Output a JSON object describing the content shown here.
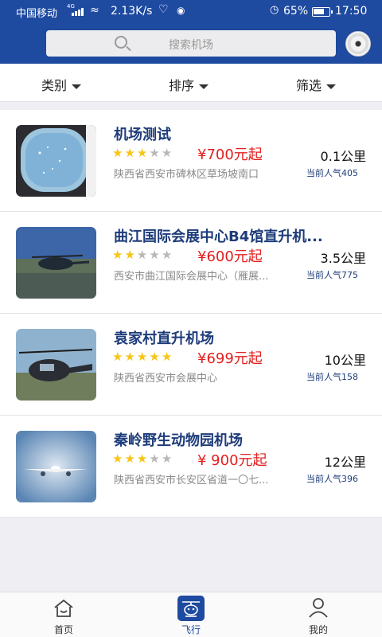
{
  "status_bar": {
    "carrier": "中国移动",
    "network": "4G",
    "speed": "2.13K/s",
    "battery": "65%",
    "time": "17:50"
  },
  "search": {
    "placeholder": "搜索机场",
    "icon": "search-icon"
  },
  "filters": [
    {
      "label": "类别"
    },
    {
      "label": "排序"
    },
    {
      "label": "筛选"
    }
  ],
  "airports": [
    {
      "name": "机场测试",
      "rating": 3,
      "price": "¥700元起",
      "distance": "0.1公里",
      "address": "陕西省西安市碑林区草场坡南口",
      "popularity": "当前人气405"
    },
    {
      "name": "曲江国际会展中心B4馆直升机...",
      "rating": 2,
      "price": "¥600元起",
      "distance": "3.5公里",
      "address": "西安市曲江国际会展中心（雁展...",
      "popularity": "当前人气775"
    },
    {
      "name": "袁家村直升机场",
      "rating": 5,
      "price": "¥699元起",
      "distance": "10公里",
      "address": "陕西省西安市会展中心",
      "popularity": "当前人气158"
    },
    {
      "name": "秦岭野生动物园机场",
      "rating": 3,
      "price": "¥ 900元起",
      "distance": "12公里",
      "address": "陕西省西安市长安区省道一〇七...",
      "popularity": "当前人气396"
    }
  ],
  "tabs": [
    {
      "label": "首页",
      "icon": "home-icon"
    },
    {
      "label": "飞行",
      "icon": "flight-icon",
      "active": true
    },
    {
      "label": "我的",
      "icon": "user-icon"
    }
  ],
  "colors": {
    "brand": "#1e4aa0",
    "price": "#e31f1f",
    "star": "#f6c516"
  }
}
